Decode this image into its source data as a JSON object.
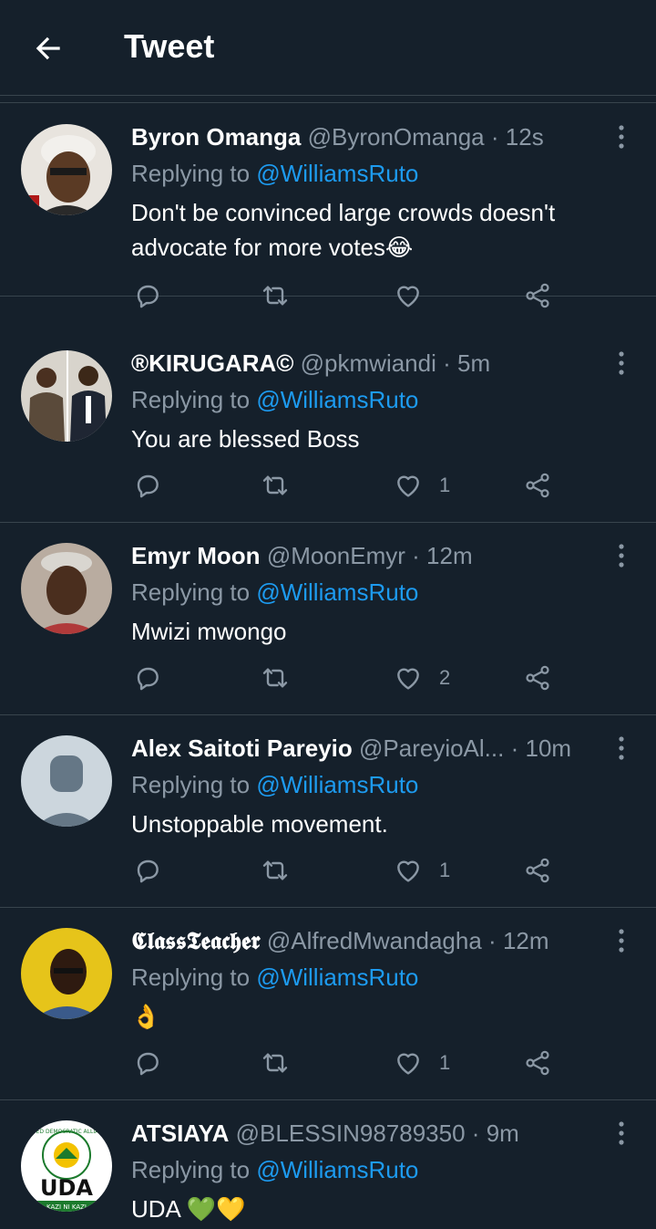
{
  "header": {
    "title": "Tweet"
  },
  "colors": {
    "background": "#15202b",
    "accent": "#1d9bf0",
    "muted": "#8b98a5",
    "divider": "#38444d"
  },
  "tweets": [
    {
      "name": "Byron Omanga",
      "handle": "@ByronOmanga",
      "dot": "·",
      "time": "12s",
      "reply_prefix": "Replying to",
      "reply_to": "@WilliamsRuto",
      "text": "Don't be convinced large crowds doesn't advocate for more votes😂",
      "likes": ""
    },
    {
      "name": "®KIRUGARA©",
      "handle": "@pkmwiandi",
      "dot": "·",
      "time": "5m",
      "reply_prefix": "Replying to",
      "reply_to": "@WilliamsRuto",
      "text": "You are blessed Boss",
      "likes": "1"
    },
    {
      "name": "Emyr Moon",
      "handle": "@MoonEmyr",
      "dot": "·",
      "time": "12m",
      "reply_prefix": "Replying to",
      "reply_to": "@WilliamsRuto",
      "text": "Mwizi mwongo",
      "likes": "2"
    },
    {
      "name": "Alex Saitoti Pareyio",
      "handle": "@PareyioAl...",
      "dot": "·",
      "time": "10m",
      "reply_prefix": "Replying to",
      "reply_to": "@WilliamsRuto",
      "text": "Unstoppable movement.",
      "likes": "1"
    },
    {
      "name": "𝕮𝖑𝖆𝖘𝖘𝕿𝖊𝖆𝖈𝖍𝖊𝖗",
      "handle": "@AlfredMwandagha",
      "dot": "·",
      "time": "12m",
      "reply_prefix": "Replying to",
      "reply_to": "@WilliamsRuto",
      "text": "👌",
      "likes": "1"
    },
    {
      "name": "ATSIAYA",
      "handle": "@BLESSIN98789350",
      "dot": "·",
      "time": "9m",
      "reply_prefix": "Replying to",
      "reply_to": "@WilliamsRuto",
      "text": "UDA 💚💛",
      "likes": ""
    }
  ],
  "icons": {
    "back": "arrow-left-icon",
    "more": "more-vertical-icon",
    "reply": "reply-icon",
    "retweet": "retweet-icon",
    "like": "heart-icon",
    "share": "share-icon"
  },
  "avatar_texts": {
    "uda": "UDA",
    "uda_top": "UNITED DEMOCRATIC ALLIANCE",
    "uda_bottom": "KAZI NI KAZI"
  }
}
